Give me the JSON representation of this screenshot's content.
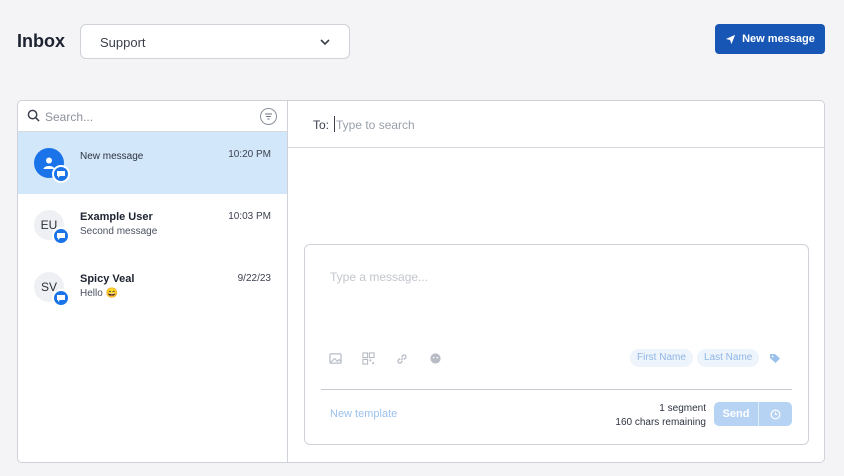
{
  "header": {
    "title": "Inbox",
    "inbox_selector": {
      "selected": "Support"
    },
    "new_message_label": "New message"
  },
  "search": {
    "placeholder": "Search..."
  },
  "conversations": [
    {
      "name": "",
      "preview": "New message",
      "time": "10:20 PM",
      "initials": "",
      "active": true
    },
    {
      "name": "Example User",
      "preview": "Second message",
      "time": "10:03 PM",
      "initials": "EU",
      "active": false
    },
    {
      "name": "Spicy Veal",
      "preview": "Hello 😄",
      "time": "9/22/23",
      "initials": "SV",
      "active": false
    }
  ],
  "to_field": {
    "label": "To:",
    "placeholder": "Type to search"
  },
  "composer": {
    "placeholder": "Type a message...",
    "tools": [
      "image-icon",
      "qr-icon",
      "link-icon",
      "emoji-icon"
    ],
    "variables": [
      "First Name",
      "Last Name"
    ],
    "new_template_label": "New template",
    "segments": "1 segment",
    "chars_remaining": "160 chars remaining",
    "send_label": "Send"
  },
  "colors": {
    "primary": "#1756b4",
    "accent": "#1a73e8",
    "active_row": "#d3e7fa",
    "send_disabled": "#b6d3f3"
  }
}
